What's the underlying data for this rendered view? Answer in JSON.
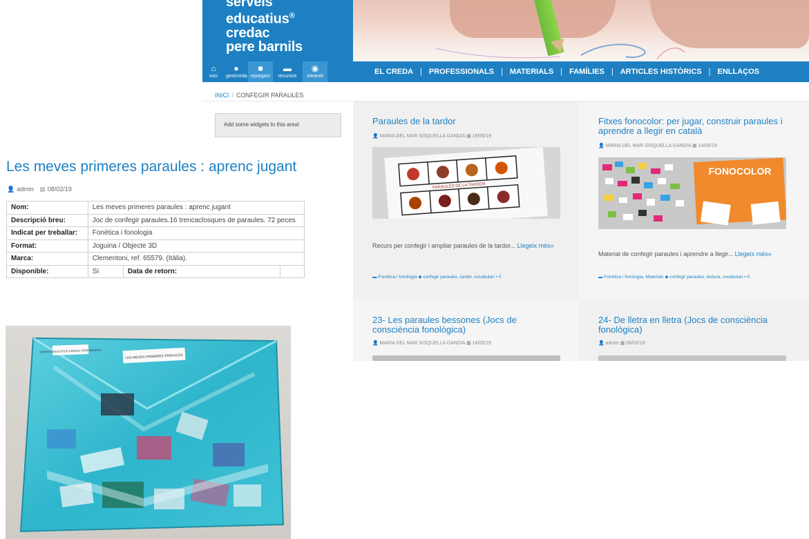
{
  "site": {
    "logo": {
      "line1": "serveis",
      "line2": "educatius",
      "line3": "credac",
      "line4": "pere barnils",
      "reg_mark": "®"
    },
    "nav_icons": [
      {
        "label": "inici",
        "icon": "home-icon"
      },
      {
        "label": "gestcreda",
        "icon": "user-icon"
      },
      {
        "label": "eporgam",
        "icon": "book-icon"
      },
      {
        "label": "recursos",
        "icon": "folder-icon"
      },
      {
        "label": "intranet",
        "icon": "android-icon"
      }
    ],
    "nav_links": [
      "EL CREDA",
      "PROFESSIONALS",
      "MATERIALS",
      "FAMÍLIES",
      "ARTICLES HISTÒRICS",
      "ENLLAÇOS"
    ],
    "nav_sep": "|",
    "breadcrumb": {
      "home": "INICI",
      "sep": "/",
      "current": "CONFEGIR PARAULES"
    },
    "widget_text": "Add some widgets to this area!",
    "posts": [
      {
        "title": "Paraules de la tardor",
        "author": "MARIA DEL MAR SISQUELLA GANDIA",
        "date": "19/09/19",
        "image_caption": "PARAULES DE LA TARDOR",
        "excerpt": "Recurs per confegir i ampliar paraules de la tardor...",
        "more": "Llegeix més»",
        "categories": "Fonètica i fonologia",
        "tags": "confegir paraules, tardor, vocabulari",
        "comments": "0"
      },
      {
        "title": "Fitxes fonocolor: per jugar, construir paraules i aprendre a llegir en català",
        "author": "MARIA DEL MAR SISQUELLA GANDIA",
        "date": "14/06/19",
        "image_caption": "FONOCOLOR",
        "excerpt": "Material de confegir paraules i aprendre a llegir...",
        "more": "Llegeix més»",
        "categories": "Fonètica i fonologia, Materials",
        "tags": "confegir paraules, lectura, vocabulari",
        "comments": "0"
      },
      {
        "title": "23- Les paraules bessones (Jocs de consciència fonològica)",
        "author": "MARIA DEL MAR SISQUELLA GANDIA",
        "date": "16/05/19"
      },
      {
        "title": "24- De lletra en lletra (Jocs de consciència fonològica)",
        "author": "admin",
        "date": "08/02/19"
      }
    ]
  },
  "product": {
    "title": "Les meves primeres paraules : aprenc jugant",
    "author": "admin",
    "date": "08/02/19",
    "rows": [
      {
        "key": "Nom:",
        "value": "Les meves primeres paraules : aprenc jugant"
      },
      {
        "key": "Descripció breu:",
        "value": "Joc de confegir paraules.16 trencaclosques de paraules. 72 peces"
      },
      {
        "key": "Indicat per treballar:",
        "value": "Fonètica i fonologia"
      },
      {
        "key": "Format:",
        "value": "Joguina / Objecte 3D"
      },
      {
        "key": "Marca:",
        "value": "Clementoni, ref. 65579. (Itàlia)."
      }
    ],
    "last_row": {
      "key": "Disponible:",
      "value": "Sí",
      "return_key": "Data de retorn:",
      "return_value": ""
    },
    "photo": {
      "label_small": "SERVEIS EDUCATIUS CREDAC PERE BARNILS",
      "label_top": "LES MEVES PRIMERES PARAULES"
    }
  },
  "colors": {
    "brand_blue": "#1e80c2",
    "card_bg": "#f0f0f0",
    "bag_blue": "#3fc3d6"
  }
}
